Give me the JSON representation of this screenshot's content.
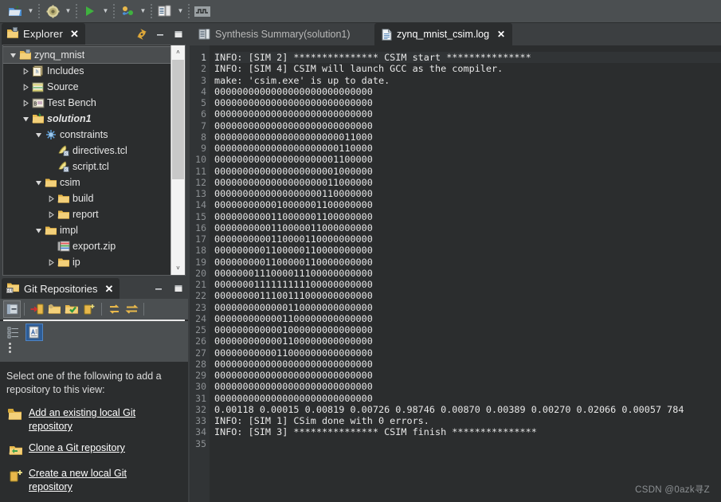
{
  "toolbar": {
    "buttons": [
      {
        "name": "open-project-icon",
        "tip": "Open Project",
        "has_arrow": true
      },
      {
        "name": "settings-gear-icon",
        "tip": "Project Settings",
        "has_arrow": true
      },
      {
        "name": "run-play-icon",
        "tip": "Run C Simulation",
        "has_arrow": true
      },
      {
        "name": "run-synthesis-icon",
        "tip": "Run C Synthesis",
        "has_arrow": true
      },
      {
        "name": "export-rtl-icon",
        "tip": "Export RTL",
        "has_arrow": true
      },
      {
        "name": "waveform-icon",
        "tip": "Open Wave Viewer",
        "has_arrow": false
      }
    ]
  },
  "explorer": {
    "tab_label": "Explorer",
    "close_label": "✕",
    "tools": [
      {
        "name": "link-with-editor-icon"
      },
      {
        "name": "minimize-view-icon",
        "glyph": "–"
      },
      {
        "name": "maximize-view-icon",
        "glyph": "■"
      }
    ],
    "tree": [
      {
        "label": "zynq_mnist",
        "depth": 0,
        "twisty": "down",
        "icon": "project-icon",
        "selected": true,
        "italic": false
      },
      {
        "label": "Includes",
        "depth": 1,
        "twisty": "right",
        "icon": "includes-icon",
        "selected": false,
        "italic": false
      },
      {
        "label": "Source",
        "depth": 1,
        "twisty": "right",
        "icon": "source-icon",
        "selected": false,
        "italic": false
      },
      {
        "label": "Test Bench",
        "depth": 1,
        "twisty": "right",
        "icon": "testbench-icon",
        "selected": false,
        "italic": false
      },
      {
        "label": "solution1",
        "depth": 1,
        "twisty": "down",
        "icon": "solution-icon",
        "selected": false,
        "italic": true
      },
      {
        "label": "constraints",
        "depth": 2,
        "twisty": "down",
        "icon": "constraints-icon",
        "selected": false,
        "italic": false
      },
      {
        "label": "directives.tcl",
        "depth": 3,
        "twisty": "none",
        "icon": "tcl-file-icon",
        "selected": false,
        "italic": false
      },
      {
        "label": "script.tcl",
        "depth": 3,
        "twisty": "none",
        "icon": "tcl-file-icon",
        "selected": false,
        "italic": false
      },
      {
        "label": "csim",
        "depth": 2,
        "twisty": "down",
        "icon": "folder-icon",
        "selected": false,
        "italic": false
      },
      {
        "label": "build",
        "depth": 3,
        "twisty": "right",
        "icon": "folder-icon",
        "selected": false,
        "italic": false
      },
      {
        "label": "report",
        "depth": 3,
        "twisty": "right",
        "icon": "folder-icon",
        "selected": false,
        "italic": false
      },
      {
        "label": "impl",
        "depth": 2,
        "twisty": "down",
        "icon": "folder-icon",
        "selected": false,
        "italic": false
      },
      {
        "label": "export.zip",
        "depth": 3,
        "twisty": "none",
        "icon": "zip-file-icon",
        "selected": false,
        "italic": false
      },
      {
        "label": "ip",
        "depth": 3,
        "twisty": "right",
        "icon": "folder-icon",
        "selected": false,
        "italic": false
      }
    ],
    "scrollbar": {
      "up_glyph": "˄",
      "down_glyph": "˅"
    }
  },
  "git": {
    "tab_label": "Git Repositories",
    "close_label": "✕",
    "tools": [
      {
        "name": "minimize-view-icon",
        "glyph": "–"
      },
      {
        "name": "maximize-view-icon",
        "glyph": "■"
      }
    ],
    "toolbar": [
      {
        "name": "collapse-all-icon",
        "active": true
      },
      {
        "name": "add-existing-repository-icon",
        "active": false
      },
      {
        "name": "clone-repository-icon",
        "active": false
      },
      {
        "name": "create-repository-icon",
        "active": false
      },
      {
        "name": "new-repository-icon",
        "active": false
      },
      {
        "name": "fetch-icon",
        "active": false
      },
      {
        "name": "push-pull-icon",
        "active": false
      }
    ],
    "message": "Select one of the following to add a repository to this view:",
    "links": [
      {
        "label": "Add an existing local Git repository",
        "icon": "add-repo-icon"
      },
      {
        "label": "Clone a Git repository",
        "icon": "clone-repo-icon"
      },
      {
        "label": "Create a new local Git repository",
        "icon": "create-repo-icon"
      }
    ]
  },
  "editor": {
    "tabs": [
      {
        "label": "Synthesis Summary(solution1)",
        "icon": "report-icon",
        "active": false,
        "closable": false
      },
      {
        "label": "zynq_mnist_csim.log",
        "icon": "log-file-icon",
        "active": true,
        "closable": true,
        "close_label": "✕"
      }
    ],
    "current_line": 1,
    "lines": [
      "INFO: [SIM 2] *************** CSIM start ***************",
      "INFO: [SIM 4] CSIM will launch GCC as the compiler.",
      "make: 'csim.exe' is up to date.",
      "0000000000000000000000000000",
      "0000000000000000000000000000",
      "0000000000000000000000000000",
      "0000000000000000000000000000",
      "0000000000000000000000011000",
      "0000000000000000000000110000",
      "0000000000000000000001100000",
      "0000000000000000000001000000",
      "0000000000000000000011000000",
      "0000000000000000000110000000",
      "0000000000010000001100000000",
      "0000000000110000001100000000",
      "0000000000110000011000000000",
      "0000000000110000110000000000",
      "0000000001100000110000000000",
      "0000000001100000110000000000",
      "0000000111000011100000000000",
      "0000000111111111100000000000",
      "0000000011100111000000000000",
      "0000000000000110000000000000",
      "0000000000001100000000000000",
      "0000000000001000000000000000",
      "0000000000001100000000000000",
      "0000000000011000000000000000",
      "0000000000000000000000000000",
      "0000000000000000000000000000",
      "0000000000000000000000000000",
      "0000000000000000000000000000",
      "0.00118 0.00015 0.00819 0.00726 0.98746 0.00870 0.00389 0.00270 0.02066 0.00057 784",
      "INFO: [SIM 1] CSim done with 0 errors.",
      "INFO: [SIM 3] *************** CSIM finish ***************",
      ""
    ]
  },
  "watermark": "CSDN @0azk寻Z",
  "colors": {
    "toolbar_bg": "#4b4f51",
    "panel_bg": "#3c3f41",
    "editor_bg": "#2b2d2e",
    "gutter_bg": "#313436",
    "text": "#e8e8e8",
    "line_number": "#8d9194",
    "selection": "#4a4d4f",
    "accent_blue": "#2d5c96",
    "folder_yellow": "#e8b84b"
  }
}
